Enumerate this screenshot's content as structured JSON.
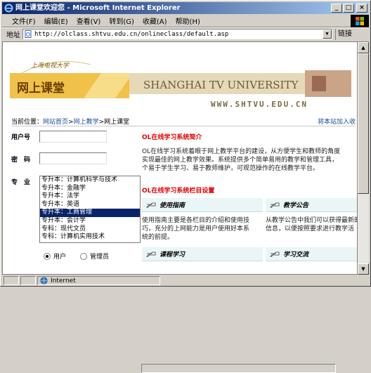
{
  "window": {
    "title": "网上课堂欢迎您 - Microsoft Internet Explorer",
    "minimize": "_",
    "maximize": "□",
    "close": "×"
  },
  "menu": [
    "文件(F)",
    "编辑(E)",
    "查看(V)",
    "转到(G)",
    "收藏(A)",
    "帮助(H)"
  ],
  "address": {
    "label": "地址",
    "url": "http://olclass.shtvu.edu.cn/onlineclass/default.asp",
    "go": "链接"
  },
  "banner": {
    "school_cn": "上海电视大学",
    "site_cn": "网上课堂",
    "school_en": "SHANGHAI TV UNIVERSITY",
    "domain": "WWW.SHTVU.EDU.CN"
  },
  "breadcrumb": {
    "prefix": "当前位置：",
    "home": "网站首页",
    "sep1": ">",
    "teaching": "网上教学",
    "sep2": ">",
    "current": "网上课堂",
    "right": "将本站加入收"
  },
  "login": {
    "user_label": "用户号",
    "pwd_label": "密　码",
    "major_label": "专　业",
    "majors": [
      "专升本：计算机科学与技术",
      "专升本：金融学",
      "专升本：法学",
      "专升本：英语",
      "专升本：工商管理",
      "专升本：会计学",
      "专科：现代文员",
      "专科：计算机实用技术"
    ],
    "selected_index": 4,
    "role_user": "用户",
    "role_admin": "管理员",
    "role_selected": "用户"
  },
  "intro": {
    "heading": "OL在线学习系统简介",
    "lines": [
      "OL在线学习系统着眼于网上教学平台的建设，从方便学生和教师的角度",
      "实现最佳的网上教学效果。系统提供多个简单易用的教学和管理工具，",
      "个易于学生学习、易于教师维护，可观范操作的在线教学平台。"
    ]
  },
  "sections": {
    "heading": "OL在线学习系统栏目设置",
    "guide": {
      "title": "使用指南",
      "lines": [
        "使用指南主要是各栏目的介绍和使用技",
        "巧，充分的上网能力是用户使用好本系",
        "统的前提。"
      ]
    },
    "notice": {
      "title": "教学公告",
      "lines": [
        "从教学公告中我们可以获得最新的",
        "信息，以便按照要求进行教学活"
      ]
    },
    "course": {
      "title": "课程学习"
    },
    "exchange": {
      "title": "学习交流"
    }
  },
  "status": {
    "text": "",
    "zone": "Internet"
  }
}
